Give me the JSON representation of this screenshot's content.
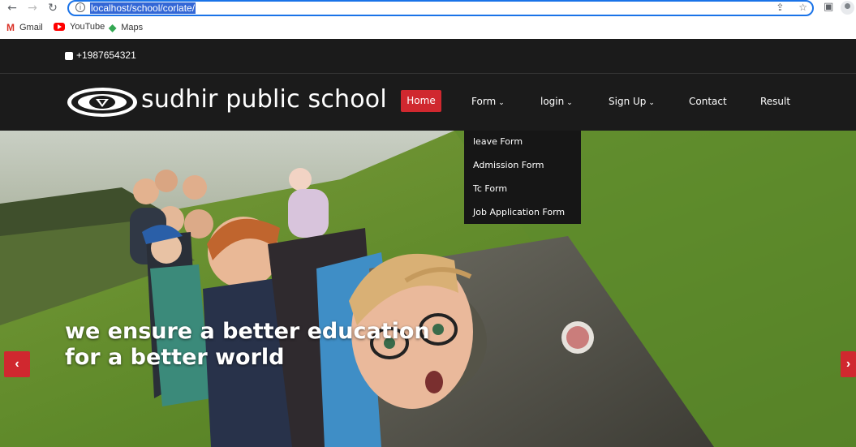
{
  "browser": {
    "url": "localhost/school/corlate/",
    "bookmarks": [
      {
        "label": "Gmail",
        "icon": "gmail-icon"
      },
      {
        "label": "YouTube",
        "icon": "youtube-icon"
      },
      {
        "label": "Maps",
        "icon": "maps-icon"
      }
    ]
  },
  "topbar": {
    "phone": "+1987654321"
  },
  "navbar": {
    "brand": "sudhir public school",
    "items": [
      {
        "label": "Home",
        "active": true
      },
      {
        "label": "Form",
        "dropdown": true
      },
      {
        "label": "login",
        "dropdown": true
      },
      {
        "label": "Sign Up",
        "dropdown": true
      },
      {
        "label": "Contact"
      },
      {
        "label": "Result"
      }
    ],
    "form_dropdown": [
      "leave Form",
      "Admission Form",
      "Tc Form",
      "Job Application Form"
    ]
  },
  "hero": {
    "caption_line1": "we ensure a better education",
    "caption_line2": "for a better world",
    "prev_icon": "chevron-left-icon",
    "next_icon": "chevron-right-icon"
  },
  "colors": {
    "accent": "#d0282f",
    "navbar_bg": "#1b1b1b",
    "dropdown_bg": "#161616"
  }
}
